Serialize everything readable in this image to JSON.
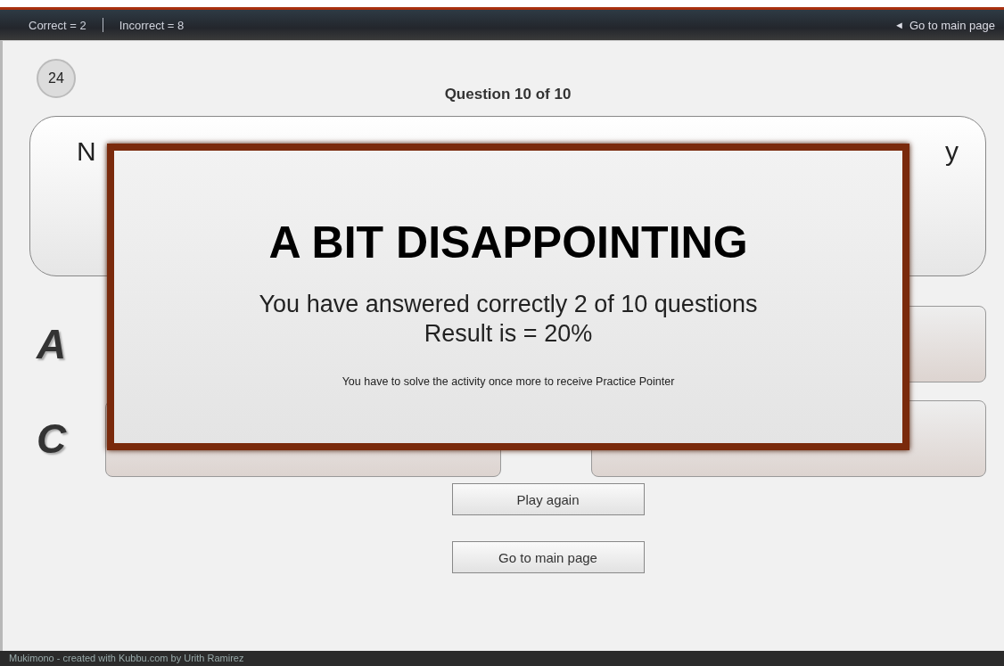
{
  "top_bar": {
    "score_items": [
      "Correct = 2",
      "Incorrect = 8"
    ],
    "back_link": {
      "icon": "◄",
      "label": "Go to main page"
    }
  },
  "timer": "24",
  "question_title": "Question 10 of 10",
  "question_text_visible": {
    "start": "N",
    "end": "y"
  },
  "answers": [
    {
      "letter": "A",
      "kind": "covered"
    },
    {
      "kind": "option"
    },
    {
      "letter": "C",
      "kind": "option"
    },
    {
      "kind": "option"
    }
  ],
  "result_dialog": {
    "title": "A BIT DISAPPOINTING",
    "summary": "You have answered correctly 2 of 10 questions",
    "result": "Result is = 20%",
    "note": "You have to solve the activity once more to receive Practice Pointer"
  },
  "buttons": [
    "Play again",
    "Go to main page"
  ],
  "footer": "Mukimono - created with Kubbu.com by Urith Ramirez"
}
